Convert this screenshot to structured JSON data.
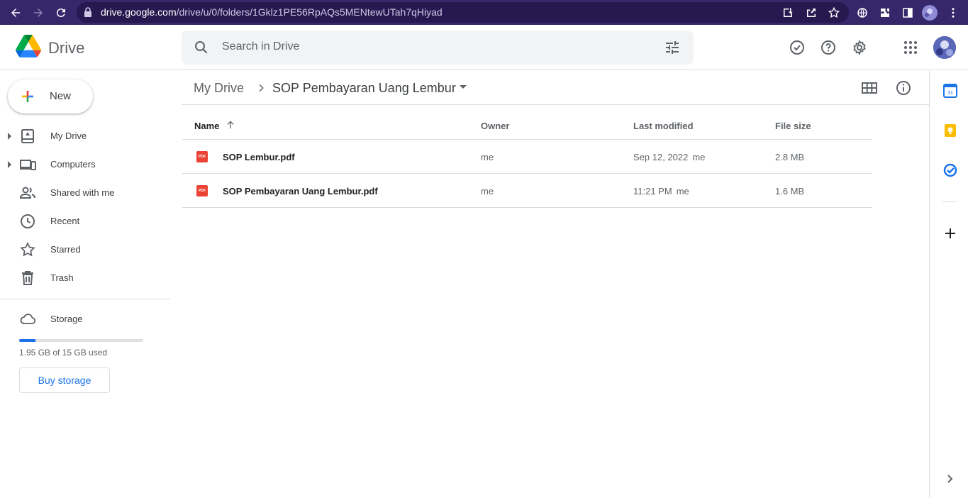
{
  "browser": {
    "url_host": "drive.google.com",
    "url_path": "/drive/u/0/folders/1Gklz1PE56RpAQs5MENtewUTah7qHiyad"
  },
  "app": {
    "name": "Drive"
  },
  "search": {
    "placeholder": "Search in Drive"
  },
  "sidebar": {
    "new_label": "New",
    "items": [
      {
        "label": "My Drive",
        "icon": "my-drive-icon"
      },
      {
        "label": "Computers",
        "icon": "computers-icon"
      },
      {
        "label": "Shared with me",
        "icon": "shared-icon"
      },
      {
        "label": "Recent",
        "icon": "clock-icon"
      },
      {
        "label": "Starred",
        "icon": "star-icon"
      },
      {
        "label": "Trash",
        "icon": "trash-icon"
      }
    ],
    "storage": {
      "label": "Storage",
      "used_text": "1.95 GB of 15 GB used",
      "used_fraction": 0.13,
      "buy_label": "Buy storage"
    }
  },
  "breadcrumb": {
    "root": "My Drive",
    "current": "SOP Pembayaran Uang Lembur"
  },
  "table": {
    "headers": {
      "name": "Name",
      "owner": "Owner",
      "modified": "Last modified",
      "size": "File size"
    },
    "rows": [
      {
        "name": "SOP Lembur.pdf",
        "owner": "me",
        "modified": "Sep 12, 2022",
        "modified_by": "me",
        "size": "2.8 MB"
      },
      {
        "name": "SOP Pembayaran Uang Lembur.pdf",
        "owner": "me",
        "modified": "11:21 PM",
        "modified_by": "me",
        "size": "1.6 MB"
      }
    ]
  },
  "colors": {
    "accent": "#1a73e8",
    "pdf": "#ea4335",
    "chrome": "#35276a"
  }
}
